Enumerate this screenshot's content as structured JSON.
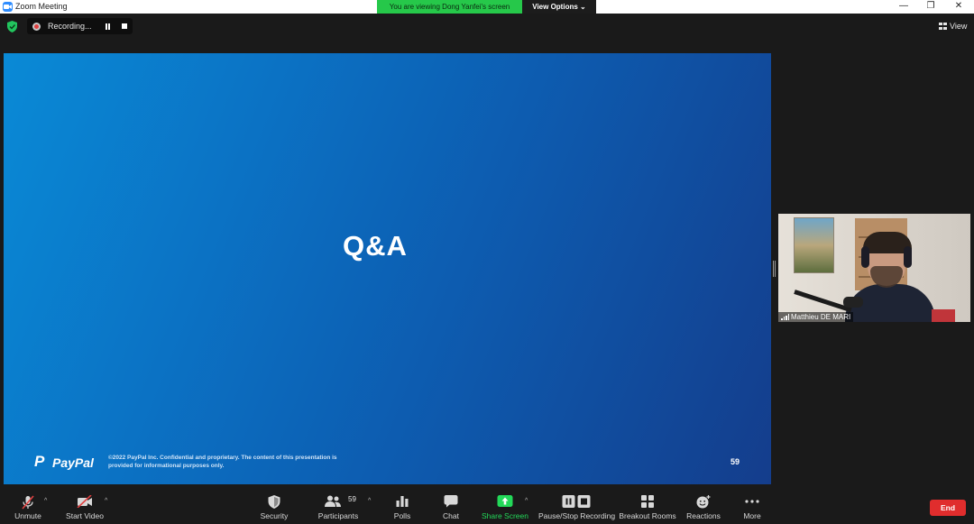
{
  "window": {
    "title": "Zoom Meeting",
    "viewing_banner": "You are viewing Dong Yanfei's screen",
    "view_options": "View Options ⌄",
    "minimize": "—",
    "restore": "❐",
    "close": "✕"
  },
  "top_bar": {
    "recording_label": "Recording...",
    "view_label": "View"
  },
  "slide": {
    "title": "Q&A",
    "brand_mark": "P",
    "brand": "PayPal",
    "footer_line1": "©2022 PayPal Inc. Confidential and proprietary. The content of this presentation is",
    "footer_line2": "provided for informational purposes only.",
    "page_number": "59"
  },
  "participant": {
    "name": "Matthieu DE MARI"
  },
  "toolbar": {
    "unmute": "Unmute",
    "start_video": "Start Video",
    "security": "Security",
    "participants": "Participants",
    "participants_count": "59",
    "polls": "Polls",
    "chat": "Chat",
    "share_screen": "Share Screen",
    "pause_stop_recording": "Pause/Stop Recording",
    "breakout_rooms": "Breakout Rooms",
    "reactions": "Reactions",
    "more": "More",
    "end": "End",
    "caret": "^"
  },
  "colors": {
    "banner_green": "#26c84a",
    "share_green": "#23d959",
    "end_red": "#e02d2d",
    "mute_red": "#e04040",
    "slide_blue": "#0b72c4"
  }
}
